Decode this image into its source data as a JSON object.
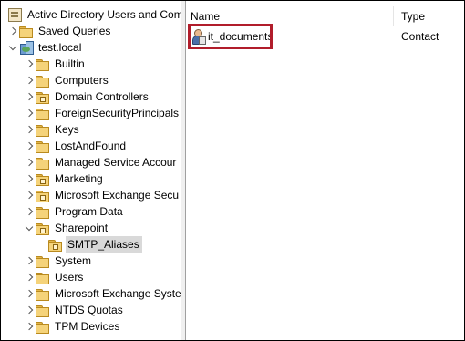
{
  "tree": {
    "root_label": "Active Directory Users and Com",
    "saved_queries_label": "Saved Queries",
    "domain_label": "test.local",
    "items": [
      {
        "label": "Builtin"
      },
      {
        "label": "Computers"
      },
      {
        "label": "Domain Controllers"
      },
      {
        "label": "ForeignSecurityPrincipals"
      },
      {
        "label": "Keys"
      },
      {
        "label": "LostAndFound"
      },
      {
        "label": "Managed Service Accour"
      },
      {
        "label": "Marketing"
      },
      {
        "label": "Microsoft Exchange Secu"
      },
      {
        "label": "Program Data"
      },
      {
        "label": "Sharepoint"
      },
      {
        "label": "SMTP_Aliases"
      },
      {
        "label": "System"
      },
      {
        "label": "Users"
      },
      {
        "label": "Microsoft Exchange Syste"
      },
      {
        "label": "NTDS Quotas"
      },
      {
        "label": "TPM Devices"
      }
    ]
  },
  "list": {
    "columns": {
      "name": "Name",
      "type": "Type"
    },
    "rows": [
      {
        "name": "it_documents",
        "type": "Contact"
      }
    ]
  },
  "colors": {
    "highlight_border": "#b11d2b",
    "selection": "#d9d9d9"
  },
  "icons": {
    "root": "ad-console-icon",
    "saved_queries": "folder-icon",
    "domain": "domain-icon",
    "ou": "ou-folder-icon",
    "container": "folder-icon",
    "contact": "contact-icon"
  }
}
